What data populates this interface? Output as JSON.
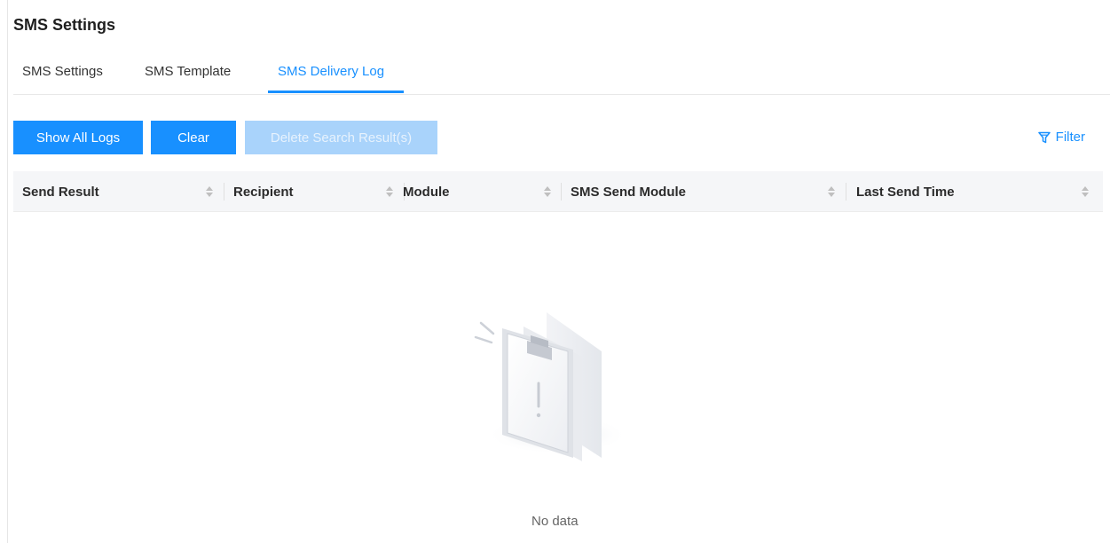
{
  "page": {
    "title": "SMS Settings"
  },
  "tabs": [
    {
      "label": "SMS Settings",
      "active": false
    },
    {
      "label": "SMS Template",
      "active": false
    },
    {
      "label": "SMS Delivery Log",
      "active": true
    }
  ],
  "toolbar": {
    "show_all_logs": "Show All Logs",
    "clear": "Clear",
    "delete_search_results": "Delete Search Result(s)",
    "filter": "Filter"
  },
  "table": {
    "columns": [
      "Send Result",
      "Recipient",
      "Module",
      "SMS Send Module",
      "Last Send Time"
    ],
    "rows": []
  },
  "empty_state": {
    "text": "No data"
  },
  "colors": {
    "accent": "#1890ff",
    "accent_disabled": "#a9d3fb",
    "header_bg": "#f5f6f8"
  },
  "icons": {
    "filter": "filter-funnel-icon",
    "empty": "empty-clipboard-icon",
    "sort": "sort-caret-icon"
  }
}
